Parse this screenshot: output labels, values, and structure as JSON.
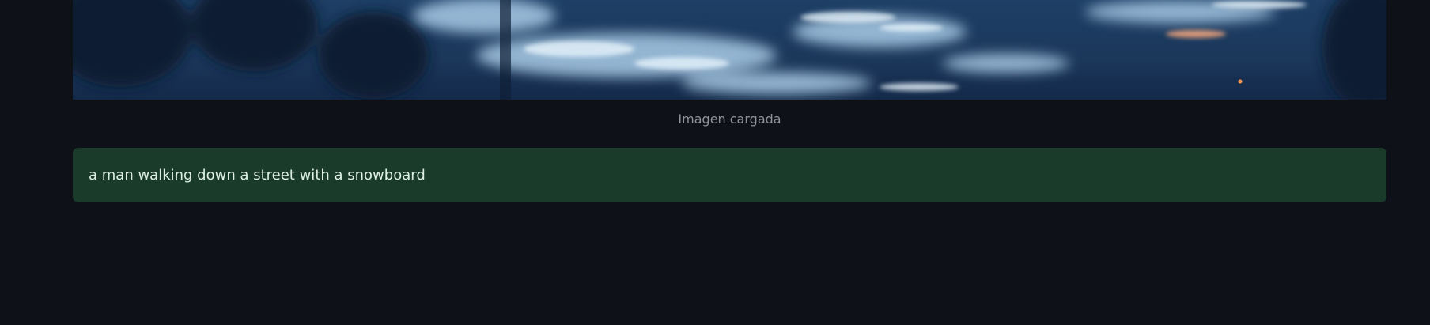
{
  "image": {
    "caption": "Imagen cargada"
  },
  "result": {
    "text": "a man walking down a street with a snowboard"
  },
  "colors": {
    "background": "#0e1117",
    "success_bg": "#1a3a2a",
    "success_text": "#dff0e2",
    "caption_text": "#8e929b"
  }
}
